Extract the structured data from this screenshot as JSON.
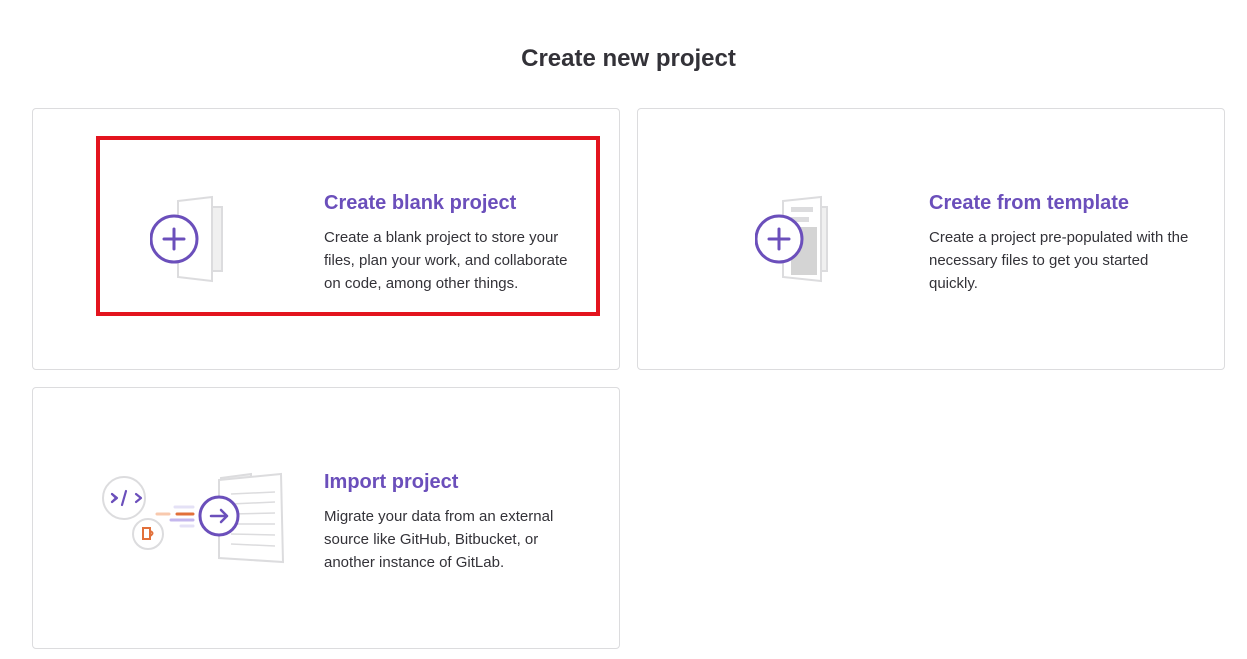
{
  "page": {
    "title": "Create new project"
  },
  "cards": [
    {
      "id": "blank",
      "title": "Create blank project",
      "description": "Create a blank project to store your files, plan your work, and collaborate on code, among other things.",
      "icon": "blank-project-plus-icon"
    },
    {
      "id": "template",
      "title": "Create from template",
      "description": "Create a project pre-populated with the necessary files to get you started quickly.",
      "icon": "template-project-plus-icon"
    },
    {
      "id": "import",
      "title": "Import project",
      "description": "Migrate your data from an external source like GitHub, Bitbucket, or another instance of GitLab.",
      "icon": "import-project-arrow-icon"
    }
  ],
  "colors": {
    "accent": "#6b4fbb",
    "highlight": "#e3141e",
    "border": "#dcdcde",
    "orange": "#e2703a"
  }
}
